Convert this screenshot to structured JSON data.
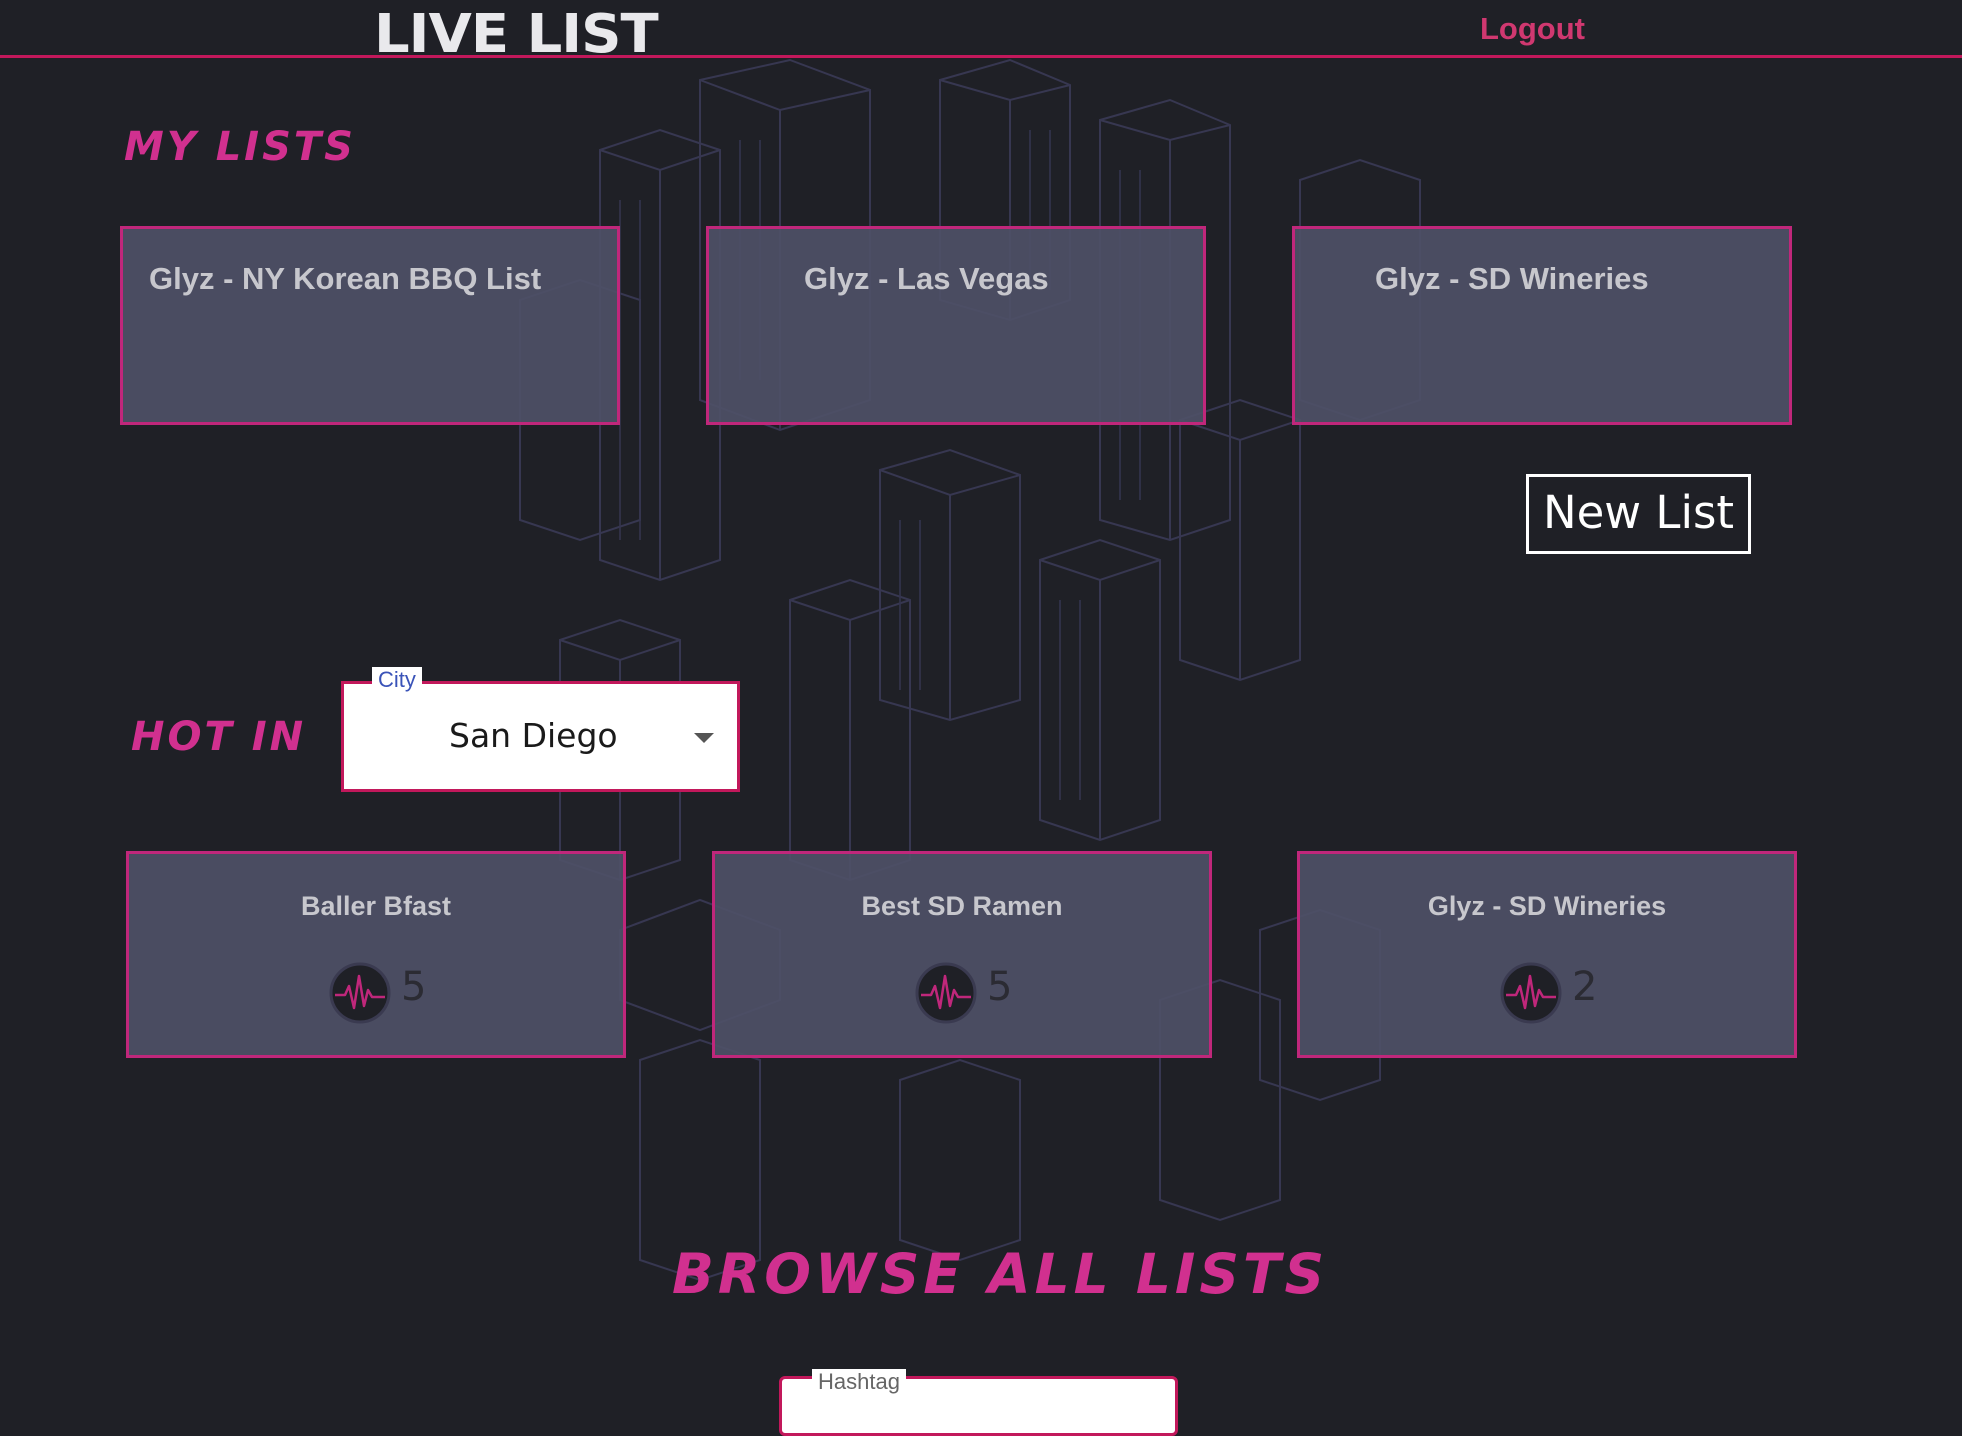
{
  "header": {
    "logo_text": "LIVE LIST",
    "logout_label": "Logout"
  },
  "my_lists": {
    "title": "MY LISTS",
    "cards": [
      {
        "title": "Glyz - NY Korean BBQ List"
      },
      {
        "title": "Glyz - Las Vegas"
      },
      {
        "title": "Glyz - SD Wineries"
      }
    ],
    "new_list_label": "New List"
  },
  "hot_in": {
    "title": "HOT IN",
    "city_select": {
      "label": "City",
      "value": "San Diego"
    },
    "cards": [
      {
        "title": "Baller Bfast",
        "count": "5",
        "icon": "pulse-icon"
      },
      {
        "title": "Best SD Ramen",
        "count": "5",
        "icon": "pulse-icon"
      },
      {
        "title": "Glyz - SD Wineries",
        "count": "2",
        "icon": "pulse-icon"
      }
    ]
  },
  "browse": {
    "title": "BROWSE ALL LISTS",
    "hashtag_field": {
      "label": "Hashtag"
    }
  },
  "colors": {
    "accent": "#c2185b",
    "title_magenta": "#d1308f",
    "background": "#1f2026",
    "card_bg": "#4e5066"
  }
}
